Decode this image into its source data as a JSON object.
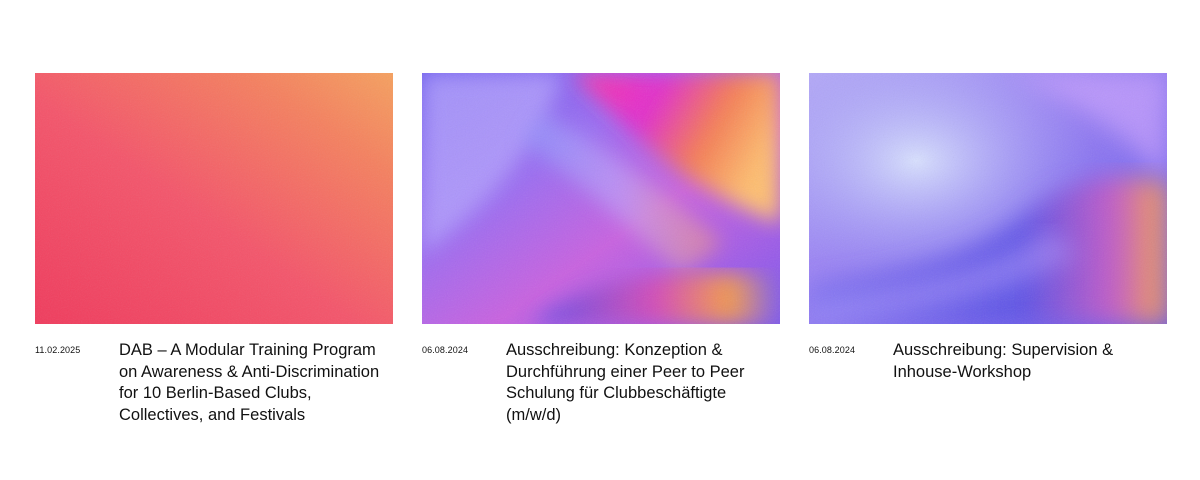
{
  "posts": [
    {
      "date": "11.02.2025",
      "title": "DAB – A Modular Training Program on Awareness & Anti-Discrimination for 10 Berlin-Based Clubs, Collectives, and Festivals",
      "image_colors": [
        "#f0405a",
        "#f7a060"
      ]
    },
    {
      "date": "06.08.2024",
      "title": "Ausschreibung: Konzeption & Durchführung einer Peer to Peer Schulung für Clubbeschäftigte (m/w/d)",
      "image_colors": [
        "#7b5cf0",
        "#d63cc8",
        "#f7a048"
      ]
    },
    {
      "date": "06.08.2024",
      "title": "Ausschreibung: Supervision & Inhouse-Workshop",
      "image_colors": [
        "#a48cf5",
        "#6b5de8",
        "#f2a34e"
      ]
    }
  ]
}
